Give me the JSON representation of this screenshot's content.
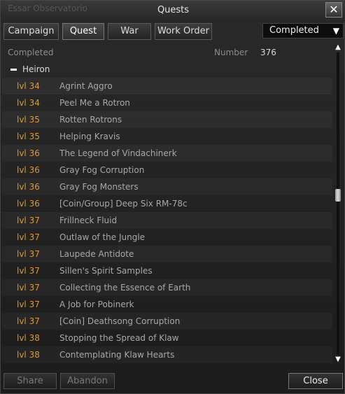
{
  "window": {
    "title": "Quests",
    "background_text": "Essar Observatorio",
    "close_symbol": "✕"
  },
  "tabs": [
    {
      "label": "Campaign",
      "active": false
    },
    {
      "label": "Quest",
      "active": true
    },
    {
      "label": "War",
      "active": false
    },
    {
      "label": "Work Order",
      "active": false
    }
  ],
  "filter": {
    "selected": "Completed",
    "arrow": "▼"
  },
  "header": {
    "status_label": "Completed",
    "number_label": "Number",
    "number_value": "376"
  },
  "group": {
    "name": "Heiron",
    "expanded": true
  },
  "quests": [
    {
      "level": "lvl 34",
      "name": "Agrint Aggro"
    },
    {
      "level": "lvl 34",
      "name": "Peel Me a Rotron"
    },
    {
      "level": "lvl 35",
      "name": "Rotten Rotrons"
    },
    {
      "level": "lvl 35",
      "name": "Helping Kravis"
    },
    {
      "level": "lvl 36",
      "name": "The Legend of Vindachinerk"
    },
    {
      "level": "lvl 36",
      "name": "Gray Fog Corruption"
    },
    {
      "level": "lvl 36",
      "name": "Gray Fog Monsters"
    },
    {
      "level": "lvl 36",
      "name": "[Coin/Group] Deep Six RM-78c"
    },
    {
      "level": "lvl 37",
      "name": "Frillneck Fluid"
    },
    {
      "level": "lvl 37",
      "name": "Outlaw of the Jungle"
    },
    {
      "level": "lvl 37",
      "name": "Laupede Antidote"
    },
    {
      "level": "lvl 37",
      "name": "Sillen's Spirit Samples"
    },
    {
      "level": "lvl 37",
      "name": "Collecting the Essence of Earth"
    },
    {
      "level": "lvl 37",
      "name": "A Job for Pobinerk"
    },
    {
      "level": "lvl 37",
      "name": "[Coin] Deathsong Corruption"
    },
    {
      "level": "lvl 38",
      "name": "Stopping the Spread of Klaw"
    },
    {
      "level": "lvl 38",
      "name": "Contemplating Klaw Hearts"
    }
  ],
  "buttons": {
    "share": "Share",
    "abandon": "Abandon",
    "close": "Close"
  },
  "scrollbar": {
    "up_arrow": "▲",
    "down_arrow": "▼",
    "position_fraction": 0.47
  },
  "colors": {
    "level_text": "#d89a3a",
    "quest_text": "#a8a8a8",
    "accent": "#ffffff"
  }
}
